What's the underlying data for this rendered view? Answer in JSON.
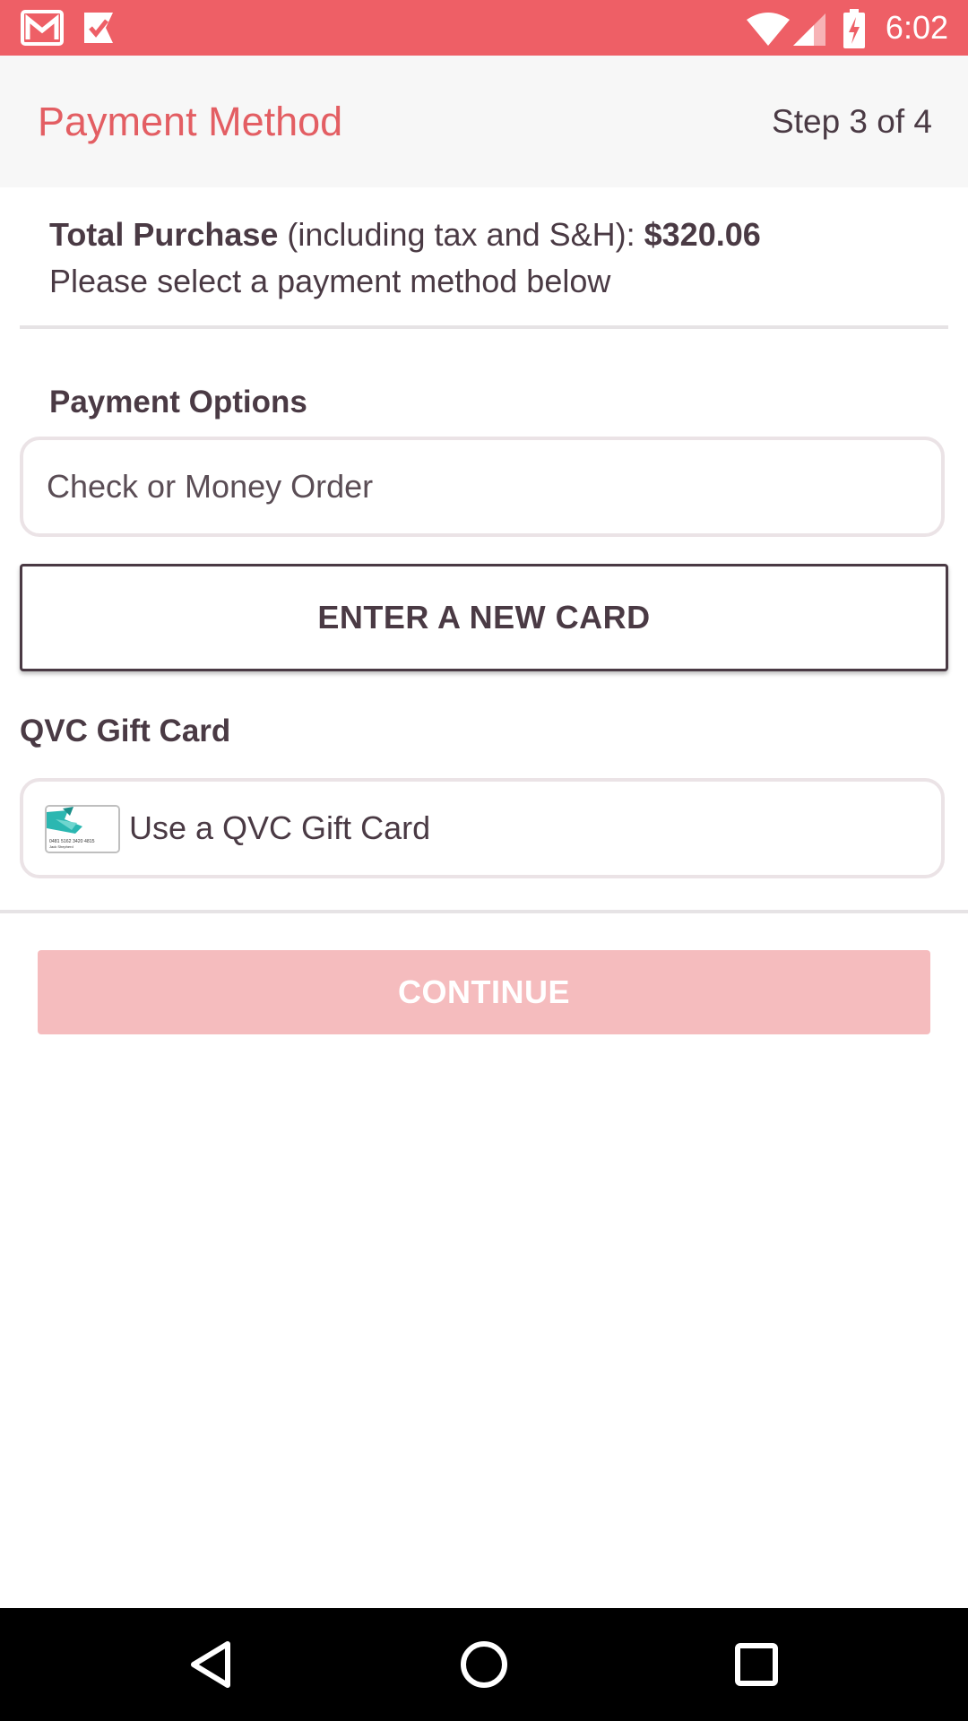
{
  "status_bar": {
    "time": "6:02",
    "background_color": "#ee5f66",
    "left_icons": [
      "gmail-icon",
      "checkmark-notification-icon"
    ],
    "right_icons": [
      "wifi-icon",
      "cell-signal-icon",
      "battery-charging-icon"
    ]
  },
  "header": {
    "title": "Payment Method",
    "step": "Step 3 of 4",
    "title_color": "#e35e63"
  },
  "summary": {
    "total_label": "Total Purchase",
    "total_note": " (including tax and S&H): ",
    "total_amount": "$320.06",
    "instruction": "Please select a payment method below"
  },
  "payment_options": {
    "heading": "Payment Options",
    "check_option": "Check or Money Order",
    "new_card_button": "ENTER A NEW CARD"
  },
  "gift_card": {
    "heading": "QVC Gift Card",
    "option_label": "Use a QVC Gift Card",
    "thumb_icon": "gift-card-icon",
    "thumb_number": "0481 5162 3420 4815",
    "thumb_name": "Jack Shepherd"
  },
  "actions": {
    "continue_label": "CONTINUE",
    "continue_color": "#f5bcbe",
    "continue_enabled": false
  },
  "nav_bar": {
    "icons": [
      "back-icon",
      "home-icon",
      "recents-icon"
    ]
  }
}
